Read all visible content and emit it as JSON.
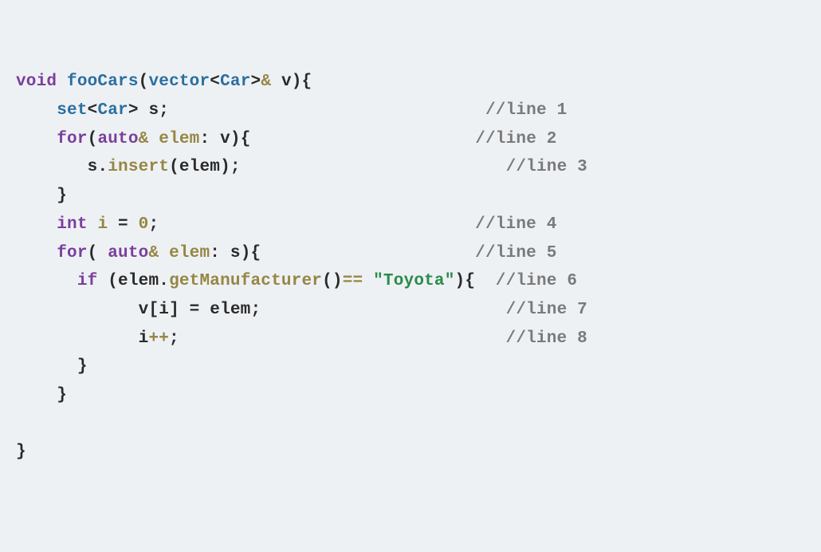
{
  "line1": {
    "kw_void": "void",
    "fname": "fooCars",
    "lparen": "(",
    "vector": "vector",
    "lt": "<",
    "car": "Car",
    "gt": ">",
    "amp": "&",
    "sp": " ",
    "v": "v",
    "rparen_brace": "){"
  },
  "line2": {
    "indent": "    ",
    "set": "set",
    "lt": "<",
    "car": "Car",
    "gt": ">",
    "sp": " ",
    "s": "s",
    "semi": ";",
    "gap": "                               ",
    "comment": "//line 1"
  },
  "line3": {
    "indent": "    ",
    "for": "for",
    "lparen": "(",
    "auto": "auto",
    "amp": "&",
    "sp": " ",
    "elem": "elem",
    "colon": ": ",
    "v": "v",
    "rparen_brace": "){",
    "gap": "                      ",
    "comment": "//line 2"
  },
  "line4": {
    "indent": "       ",
    "s": "s",
    "dot": ".",
    "insert": "insert",
    "lparen": "(",
    "elem": "elem",
    "rparen_semi": ");",
    "gap": "                          ",
    "comment": "//line 3"
  },
  "line5": {
    "indent": "    ",
    "brace": "}"
  },
  "line6": {
    "indent": "    ",
    "int": "int",
    "sp": " ",
    "i": "i",
    "eq": " = ",
    "zero": "0",
    "semi": ";",
    "gap": "                               ",
    "comment": "//line 4"
  },
  "line7": {
    "indent": "    ",
    "for": "for",
    "lparen": "( ",
    "auto": "auto",
    "amp": "&",
    "sp": " ",
    "elem": "elem",
    "colon": ": ",
    "s": "s",
    "rparen_brace": "){",
    "gap": "                     ",
    "comment": "//line 5"
  },
  "line8": {
    "indent": "      ",
    "if": "if",
    "sp": " ",
    "lparen": "(",
    "elem": "elem",
    "dot": ".",
    "method": "getManufacturer",
    "parens": "()",
    "eqeq": "== ",
    "str": "\"Toyota\"",
    "rparen_brace": "){",
    "gap": "  ",
    "comment": "//line 6"
  },
  "line9": {
    "indent": "            ",
    "v": "v",
    "lbrack": "[",
    "i": "i",
    "rbrack": "]",
    "eq": " = ",
    "elem": "elem",
    "semi": ";",
    "gap": "                        ",
    "comment": "//line 7"
  },
  "line10": {
    "indent": "            ",
    "i": "i",
    "inc": "++",
    "semi": ";",
    "gap": "                                ",
    "comment": "//line 8"
  },
  "line11": {
    "indent": "      ",
    "brace": "}"
  },
  "line12": {
    "indent": "    ",
    "brace": "}"
  },
  "line13": {
    "brace": "}"
  }
}
